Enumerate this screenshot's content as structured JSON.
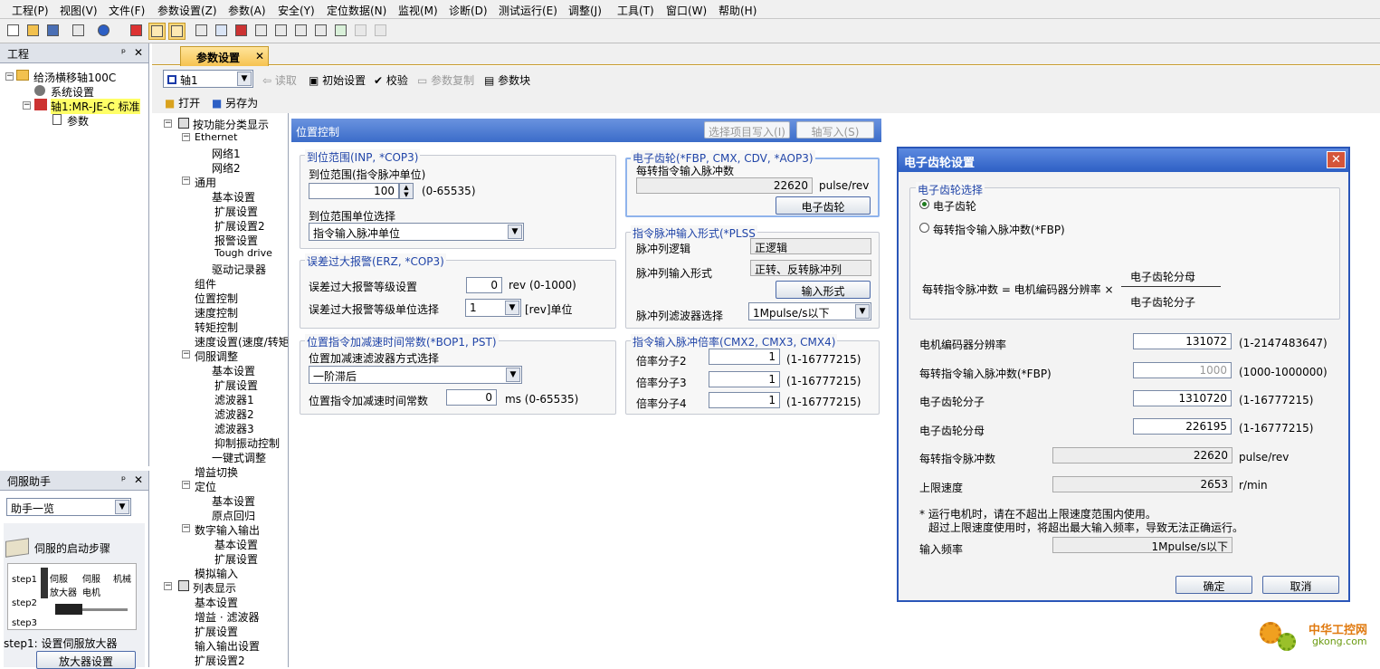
{
  "menu": [
    "工程(P)",
    "视图(V)",
    "文件(F)",
    "参数设置(Z)",
    "参数(A)",
    "安全(Y)",
    "定位数据(N)",
    "监视(M)",
    "诊断(D)",
    "测试运行(E)",
    "调整(J)",
    "工具(T)",
    "窗口(W)",
    "帮助(H)"
  ],
  "project_panel": {
    "title": "工程",
    "root": "给汤横移轴100C",
    "system": "系统设置",
    "axis": "轴1:MR-JE-C 标准",
    "param": "参数"
  },
  "assist_panel": {
    "title": "伺服助手",
    "select": "助手一览",
    "guide_title": "伺服的启动步骤",
    "step1": "step1",
    "step2": "step2",
    "step3": "step3",
    "amp": "伺服\n放大器",
    "motor": "伺服\n电机",
    "machine": "机械",
    "step_text": "step1: 设置伺服放大器",
    "step_button": "放大器设置"
  },
  "tab": {
    "label": "参数设置"
  },
  "axis_toolbar": {
    "axis_select": "轴1",
    "read": "读取",
    "init": "初始设置",
    "verify": "校验",
    "copy": "参数复制",
    "block": "参数块",
    "open": "打开",
    "saveas": "另存为"
  },
  "param_tree": [
    "按功能分类显示",
    "Ethernet",
    "网络1",
    "网络2",
    "通用",
    "基本设置",
    "扩展设置",
    "扩展设置2",
    "报警设置",
    "Tough drive",
    "驱动记录器",
    "组件",
    "位置控制",
    "速度控制",
    "转矩控制",
    "速度设置(速度/转矩",
    "伺服调整",
    "基本设置",
    "扩展设置",
    "滤波器1",
    "滤波器2",
    "滤波器3",
    "抑制振动控制",
    "一键式调整",
    "增益切换",
    "定位",
    "基本设置",
    "原点回归",
    "数字输入输出",
    "基本设置",
    "扩展设置",
    "模拟输入",
    "列表显示",
    "基本设置",
    "增益 · 滤波器",
    "扩展设置",
    "输入输出设置",
    "扩展设置2"
  ],
  "section": {
    "title": "位置控制",
    "write_selected": "选择项目写入(I)",
    "axis_write": "轴写入(S)"
  },
  "inp_group": {
    "title": "到位范围(INP, *COP3)",
    "range_label": "到位范围(指令脉冲单位)",
    "range_value": "100",
    "range_limits": "(0-65535)",
    "unit_label": "到位范围单位选择",
    "unit_value": "指令输入脉冲单位"
  },
  "erz_group": {
    "title": "误差过大报警(ERZ, *COP3)",
    "level_label": "误差过大报警等级设置",
    "level_value": "0",
    "level_unit": "rev (0-1000)",
    "unit_label": "误差过大报警等级单位选择",
    "unit_value": "1",
    "unit_suffix": "[rev]单位"
  },
  "bop_group": {
    "title": "位置指令加减速时间常数(*BOP1, PST)",
    "filter_label": "位置加减速滤波器方式选择",
    "filter_value": "一阶滞后",
    "time_label": "位置指令加减速时间常数",
    "time_value": "0",
    "time_unit": "ms (0-65535)"
  },
  "gear_group": {
    "title": "电子齿轮(*FBP, CMX, CDV, *AOP3)",
    "pulses_label": "每转指令输入脉冲数",
    "pulses_value": "22620",
    "pulses_unit": "pulse/rev",
    "button": "电子齿轮"
  },
  "plss_group": {
    "title": "指令脉冲输入形式(*PLSS",
    "logic_label": "脉冲列逻辑",
    "logic_value": "正逻辑",
    "form_label": "脉冲列输入形式",
    "form_value": "正转、反转脉冲列",
    "form_button": "输入形式",
    "filter_label": "脉冲列滤波器选择",
    "filter_value": "1Mpulse/s以下"
  },
  "cmx_group": {
    "title": "指令输入脉冲倍率(CMX2, CMX3, CMX4)",
    "rows": [
      {
        "label": "倍率分子2",
        "value": "1",
        "range": "(1-16777215)"
      },
      {
        "label": "倍率分子3",
        "value": "1",
        "range": "(1-16777215)"
      },
      {
        "label": "倍率分子4",
        "value": "1",
        "range": "(1-16777215)"
      }
    ]
  },
  "dialog": {
    "title": "电子齿轮设置",
    "choice_title": "电子齿轮选择",
    "opt1": "电子齿轮",
    "opt2": "每转指令输入脉冲数(*FBP)",
    "formula_left": "每转指令脉冲数 = 电机编码器分辨率 ×",
    "numerator": "电子齿轮分母",
    "denominator": "电子齿轮分子",
    "fields": [
      {
        "label": "电机编码器分辨率",
        "value": "131072",
        "range": "(1-2147483647)"
      },
      {
        "label": "每转指令输入脉冲数(*FBP)",
        "value": "1000",
        "range": "(1000-1000000)"
      },
      {
        "label": "电子齿轮分子",
        "value": "1310720",
        "range": "(1-16777215)"
      },
      {
        "label": "电子齿轮分母",
        "value": "226195",
        "range": "(1-16777215)"
      }
    ],
    "pulses_label": "每转指令脉冲数",
    "pulses_value": "22620",
    "pulses_unit": "pulse/rev",
    "speed_label": "上限速度",
    "speed_value": "2653",
    "speed_unit": "r/min",
    "note1": "* 运行电机时，请在不超出上限速度范围内使用。",
    "note2": "超过上限速度使用时，将超出最大输入频率，导致无法正确运行。",
    "freq_label": "输入频率",
    "freq_value": "1Mpulse/s以下",
    "ok": "确定",
    "cancel": "取消"
  },
  "watermark": {
    "cn": "中华工控网",
    "url": "gkong.com"
  }
}
